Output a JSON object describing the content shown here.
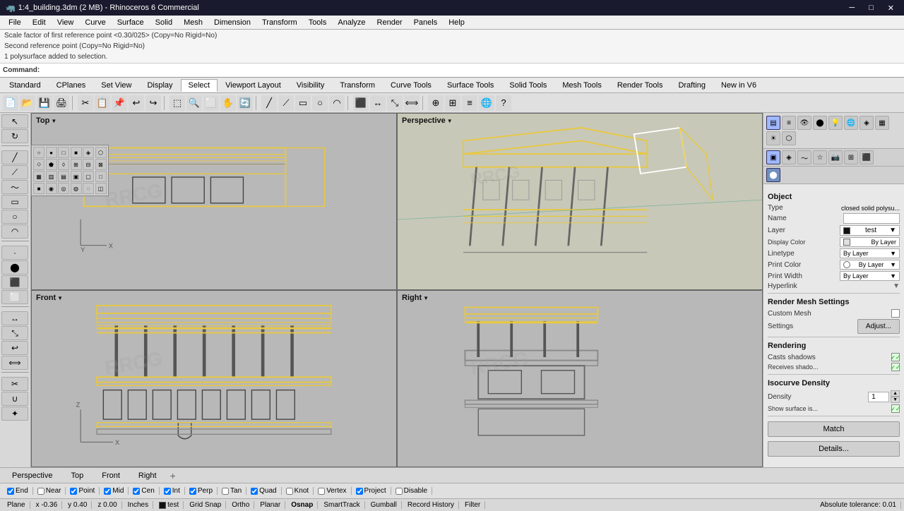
{
  "titlebar": {
    "title": "1:4_building.3dm (2 MB) - Rhinoceros 6 Commercial",
    "minimize": "─",
    "maximize": "□",
    "close": "✕"
  },
  "menubar": {
    "items": [
      "File",
      "Edit",
      "View",
      "Curve",
      "Surface",
      "Solid",
      "Mesh",
      "Dimension",
      "Transform",
      "Tools",
      "Analyze",
      "Render",
      "Panels",
      "Help"
    ]
  },
  "infobar": {
    "line1": "Scale factor of first reference point <0.30/025> (Copy=No Rigid=No)",
    "line2": "Second reference point (Copy=No Rigid=No)",
    "line3": "1 polysurface added to selection."
  },
  "commandbar": {
    "label": "Command:",
    "value": ""
  },
  "tabs": {
    "items": [
      "Standard",
      "CPlanes",
      "Set View",
      "Display",
      "Select",
      "Viewport Layout",
      "Visibility",
      "Transform",
      "Curve Tools",
      "Surface Tools",
      "Solid Tools",
      "Mesh Tools",
      "Render Tools",
      "Drafting",
      "New in V6"
    ]
  },
  "viewports": {
    "top": {
      "label": "Top",
      "arrow": "▼"
    },
    "perspective": {
      "label": "Perspective",
      "arrow": "▼"
    },
    "front": {
      "label": "Front",
      "arrow": "▼"
    },
    "right": {
      "label": "Right",
      "arrow": "▼"
    }
  },
  "vp_tabs": {
    "items": [
      "Perspective",
      "Top",
      "Front",
      "Right"
    ],
    "active": "Perspective",
    "add": "+"
  },
  "right_panel": {
    "section_object": "Object",
    "type_label": "Type",
    "type_value": "closed solid polysu...",
    "name_label": "Name",
    "name_value": "",
    "layer_label": "Layer",
    "layer_value": "test",
    "display_color_label": "Display Color",
    "display_color_value": "By Layer",
    "linetype_label": "Linetype",
    "linetype_value": "By Layer",
    "print_color_label": "Print Color",
    "print_color_value": "By Layer",
    "print_width_label": "Print Width",
    "print_width_value": "By Layer",
    "hyperlink_label": "Hyperlink",
    "hyperlink_value": "",
    "section_mesh": "Render Mesh Settings",
    "custom_mesh_label": "Custom Mesh",
    "settings_label": "Settings",
    "adjust_button": "Adjust...",
    "section_rendering": "Rendering",
    "casts_shadows_label": "Casts shadows",
    "receives_shadow_label": "Receives shado...",
    "section_isocurve": "Isocurve Density",
    "density_label": "Density",
    "density_value": "1",
    "show_surface_label": "Show surface is...",
    "match_button": "Match",
    "details_button": "Details..."
  },
  "statusbar": {
    "osnap_items": [
      "End",
      "Near",
      "Point",
      "Mid",
      "Cen",
      "Int",
      "Perp",
      "Tan",
      "Quad",
      "Knot",
      "Vertex",
      "Project",
      "Disable"
    ],
    "plane_label": "Plane",
    "x": "x -0.36",
    "y": "y 0.40",
    "z": "z 0.00",
    "units": "Inches",
    "layer": "test",
    "grid_snap": "Grid Snap",
    "ortho": "Ortho",
    "planar": "Planar",
    "osnap": "Osnap",
    "smart_track": "SmartTrack",
    "gumball": "Gumball",
    "record": "Record History",
    "filter": "Filter",
    "abs_tolerance": "Absolute tolerance: 0.01"
  },
  "icons": {
    "colors": {
      "active": "#a0b4ff",
      "yellow": "#e8c840",
      "bg": "#d0d0d0"
    }
  }
}
